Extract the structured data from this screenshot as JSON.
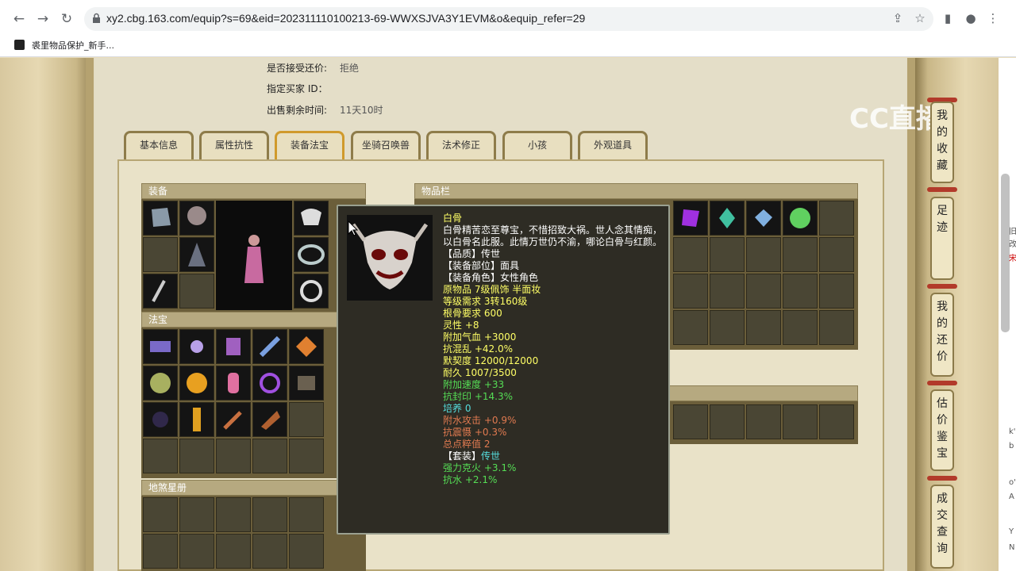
{
  "browser": {
    "url": "xy2.cbg.163.com/equip?s=69&eid=202311110100213-69-WWXSJVA3Y1EVM&o&equip_refer=29",
    "bookmark": "裘里物品保护_新手...",
    "icons": [
      "back-icon",
      "forward-icon",
      "reload-icon",
      "lock-icon",
      "share-icon",
      "star-icon",
      "sidebar-icon",
      "profile-icon",
      "menu-icon"
    ]
  },
  "watermark": "CC直播",
  "info": {
    "bargain_label": "是否接受还价:",
    "bargain_value": "拒绝",
    "buyer_label": "指定买家 ID：",
    "buyer_value": "",
    "time_label": "出售剩余时间:",
    "time_value": "11天10时"
  },
  "tabs": [
    "基本信息",
    "属性抗性",
    "装备法宝",
    "坐骑召唤兽",
    "法术修正",
    "小孩",
    "外观道具"
  ],
  "active_tab": "装备法宝",
  "sections": {
    "equip": "装备",
    "fabao": "法宝",
    "star": "地煞星册",
    "items": "物品栏"
  },
  "tooltip": {
    "name": "白骨",
    "desc": "白骨精苦恋至尊宝，不惜招致大祸。世人念其情痴，以白骨名此服。此情万世仍不渝，哪论白骨与红颜。",
    "lines": [
      {
        "text": "【品质】传世",
        "color": "#ffffff"
      },
      {
        "text": "【装备部位】面具",
        "color": "#ffffff"
      },
      {
        "text": "【装备角色】女性角色",
        "color": "#ffffff"
      },
      {
        "text": "原物品 7级佩饰 半面妆",
        "color": "#ffff66"
      },
      {
        "text": "等级需求 3转160级",
        "color": "#ffff66"
      },
      {
        "text": "根骨要求 600",
        "color": "#ffff66"
      },
      {
        "text": "灵性 +8",
        "color": "#ffff66"
      },
      {
        "text": "附加气血 +3000",
        "color": "#ffff66"
      },
      {
        "text": "抗混乱 +42.0%",
        "color": "#ffff66"
      },
      {
        "text": "默契度 12000/12000",
        "color": "#ffff66"
      },
      {
        "text": "耐久 1007/3500",
        "color": "#ffff66"
      },
      {
        "text": "附加速度 +33",
        "color": "#55dd55"
      },
      {
        "text": "抗封印 +14.3%",
        "color": "#55dd55"
      },
      {
        "text": "培养 0",
        "color": "#55dddd"
      },
      {
        "text": "附水攻击 +0.9%",
        "color": "#e07a50"
      },
      {
        "text": "抗震慑 +0.3%",
        "color": "#e07a50"
      },
      {
        "text": "总点粹值  2",
        "color": "#e07a50"
      },
      {
        "text": " ",
        "color": "#ffffff"
      },
      {
        "text": " ",
        "color": "#ffffff"
      }
    ],
    "set_label": "【套装】",
    "set_value": "传世",
    "set_lines": [
      "强力克火 +3.1%",
      "抗水 +2.1%"
    ]
  },
  "side_buttons": [
    {
      "label": "我的收藏"
    },
    {
      "label": "足迹"
    },
    {
      "label": "我的还价"
    },
    {
      "label": "估价鉴宝"
    },
    {
      "label": "成交查询"
    }
  ],
  "edge_text": [
    "旧",
    "改",
    "宋",
    "k'",
    "b",
    "o'",
    "A",
    "Y",
    "N"
  ]
}
